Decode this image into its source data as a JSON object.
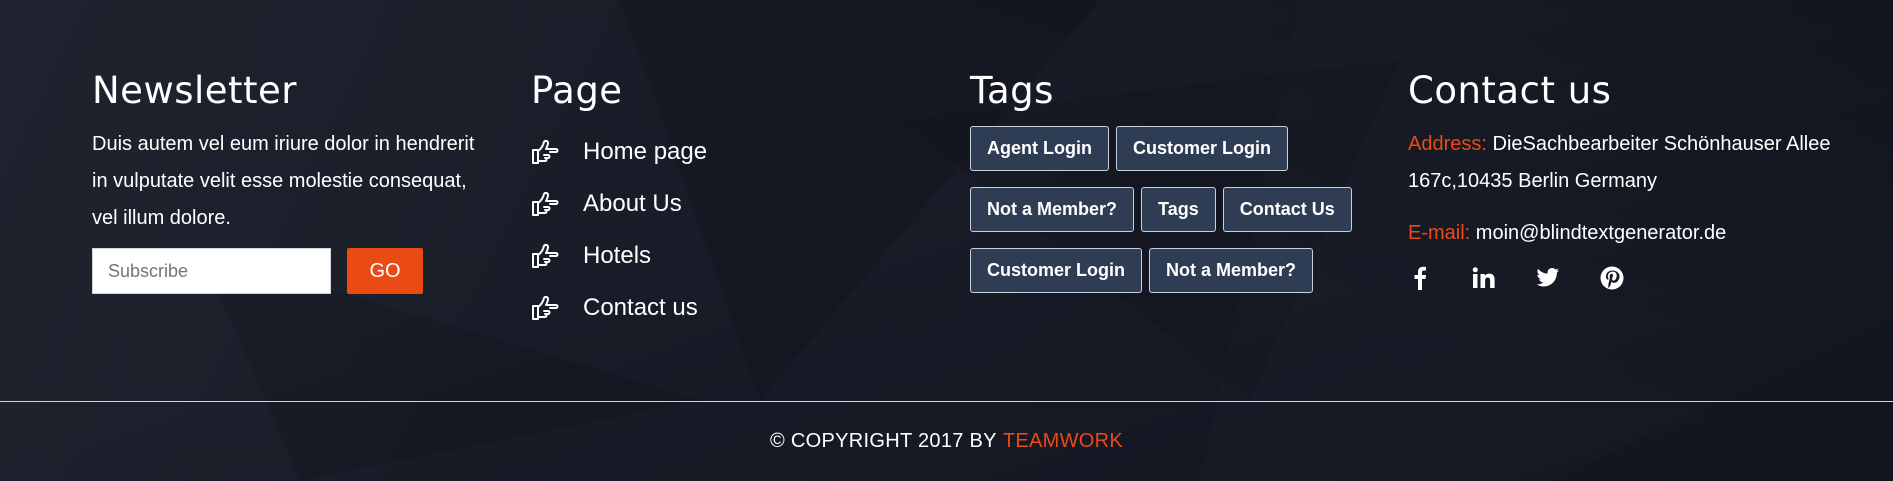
{
  "newsletter": {
    "title": "Newsletter",
    "text": "Duis autem vel eum iriure dolor in hendrerit in vulputate velit esse molestie consequat, vel illum dolore.",
    "input_placeholder": "Subscribe",
    "button_label": "GO"
  },
  "page": {
    "title": "Page",
    "icon": "hand-pointing-right-icon",
    "links": [
      "Home page",
      "About Us",
      "Hotels",
      "Contact us"
    ]
  },
  "tags": {
    "title": "Tags",
    "items": [
      "Agent Login",
      "Customer Login",
      "Not a Member?",
      "Tags",
      "Contact Us",
      "Customer Login",
      "Not a Member?"
    ]
  },
  "contact": {
    "title": "Contact us",
    "address_label": "Address:",
    "address_value": "DieSachbearbeiter Schönhauser Allee 167c,10435 Berlin Germany",
    "email_label": "E-mail:",
    "email_value": "moin@blindtextgenerator.de",
    "social": [
      "facebook-icon",
      "linkedin-icon",
      "twitter-icon",
      "pinterest-icon"
    ]
  },
  "footer": {
    "copyright": "© COPYRIGHT 2017 BY",
    "brand": "TEAMWORK"
  },
  "colors": {
    "background": "#161a26",
    "accent": "#ea4a14",
    "tag_bg": "#2e3d54"
  }
}
